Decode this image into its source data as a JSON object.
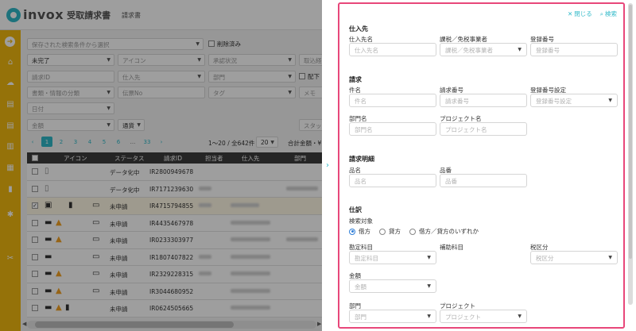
{
  "app": {
    "logo_text": "invox",
    "logo_sub": "受取請求書",
    "header_tab": "請求書"
  },
  "filters": {
    "saved_search_placeholder": "保存された検索条件から選択",
    "deleted_label": "削除済み",
    "status_value": "未完了",
    "icon_placeholder": "アイコン",
    "approval_placeholder": "承認状況",
    "import_placeholder": "取込経",
    "invoice_id_placeholder": "請求ID",
    "vendor_placeholder": "仕入先",
    "department_placeholder": "部門",
    "distribute_label": "配下",
    "doc_type_placeholder": "書類・情報の分類",
    "slip_no_placeholder": "伝票No",
    "tag_placeholder": "タグ",
    "memo_placeholder": "メモ",
    "date_placeholder": "日付",
    "amount_placeholder": "金額",
    "currency_value": "通貨",
    "staff_placeholder": "スタッ"
  },
  "pager": {
    "prev": "‹",
    "pages": [
      "1",
      "2",
      "3",
      "4",
      "5",
      "6",
      "...",
      "33"
    ],
    "next": "›",
    "info": "1〜20 / 全642件",
    "page_size": "20",
    "total": "合計金額・¥"
  },
  "table": {
    "headers": [
      "アイコン",
      "ステータス",
      "請求ID",
      "担当者",
      "仕入先",
      "部門"
    ],
    "rows": [
      {
        "status": "データ化中",
        "id": "IR2800949678"
      },
      {
        "status": "データ化中",
        "id": "IR7171239630"
      },
      {
        "status": "未申請",
        "id": "IR4715794855"
      },
      {
        "status": "未申請",
        "id": "IR4435467978"
      },
      {
        "status": "未申請",
        "id": "IR0233303977"
      },
      {
        "status": "未申請",
        "id": "IR1807407822"
      },
      {
        "status": "未申請",
        "id": "IR2329228315"
      },
      {
        "status": "未申請",
        "id": "IR3044680952"
      },
      {
        "status": "未申請",
        "id": "IR0624505665"
      }
    ]
  },
  "panel": {
    "close_label": "閉じる",
    "search_label": "検索",
    "vendor_section": {
      "title": "仕入先",
      "vendor_name_label": "仕入先名",
      "vendor_name_placeholder": "仕入先名",
      "tax_type_label": "課税／免税事業者",
      "tax_type_placeholder": "課税／免税事業者",
      "reg_no_label": "登録番号",
      "reg_no_placeholder": "登録番号"
    },
    "invoice_section": {
      "title": "請求",
      "subject_label": "件名",
      "subject_placeholder": "件名",
      "invoice_no_label": "請求番号",
      "invoice_no_placeholder": "請求番号",
      "reg_setting_label": "登録番号設定",
      "reg_setting_placeholder": "登録番号設定",
      "dept_name_label": "部門名",
      "dept_name_placeholder": "部門名",
      "project_name_label": "プロジェクト名",
      "project_name_placeholder": "プロジェクト名"
    },
    "detail_section": {
      "title": "請求明細",
      "item_name_label": "品名",
      "item_name_placeholder": "品名",
      "item_no_label": "品番",
      "item_no_placeholder": "品番"
    },
    "journal_section": {
      "title": "仕訳",
      "target_label": "検索対象",
      "radio_debit": "借方",
      "radio_credit": "貸方",
      "radio_either": "借方／貸方のいずれか",
      "account_label": "勘定科目",
      "account_placeholder": "勘定科目",
      "sub_account_label": "補助科目",
      "tax_label": "税区分",
      "tax_placeholder": "税区分",
      "amount_label": "金額",
      "amount_placeholder": "金額",
      "dept_label": "部門",
      "dept_placeholder": "部門",
      "project_label": "プロジェクト",
      "project_placeholder": "プロジェクト"
    }
  }
}
